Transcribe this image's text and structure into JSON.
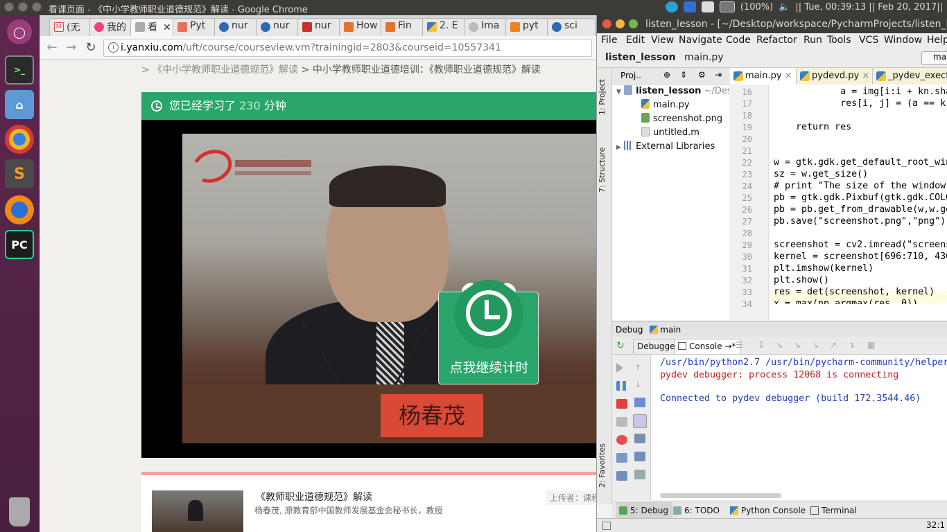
{
  "top_panel": {
    "title": "看课页面 - 《中小学教师职业道德规范》解读 - Google Chrome",
    "battery": "(100%)",
    "clock": "|| Tue, 00:39:13 || Feb 20, 2017||"
  },
  "launcher": {
    "apps": [
      "ubuntu-dash",
      "terminal",
      "files",
      "chrome",
      "sublime-text",
      "firefox",
      "pycharm",
      "trash"
    ]
  },
  "chrome": {
    "tabs": [
      {
        "label": "(无",
        "icon": "gmail-icon"
      },
      {
        "label": "我的",
        "icon": "flower-icon"
      },
      {
        "label": "看",
        "icon": "speaker-icon",
        "active": true
      },
      {
        "label": "Pyt",
        "icon": "jianshu-icon"
      },
      {
        "label": "nur",
        "icon": "blog-icon"
      },
      {
        "label": "nur",
        "icon": "blog-icon"
      },
      {
        "label": "nur",
        "icon": "csdn-icon"
      },
      {
        "label": "Hoᴡ",
        "icon": "matlab-icon"
      },
      {
        "label": "Fin",
        "icon": "matlab-icon"
      },
      {
        "label": "2. E",
        "icon": "python-icon"
      },
      {
        "label": "Ima",
        "icon": "at-icon"
      },
      {
        "label": "pyt",
        "icon": "stackoverflow-icon"
      },
      {
        "label": "sci",
        "icon": "blog-icon"
      }
    ],
    "url_host": "i.yanxiu.com",
    "url_path": "/uft/course/courseview.vm?trainingid=2803&courseid=10557341",
    "breadcrumb_prefix": "> 《中小学教师职业道德规范》解读",
    "breadcrumb_current": "> 中小学教师职业道德培训：《教师职业道德规范》解读",
    "study_prefix": "您已经学习了",
    "study_minutes": "230",
    "study_suffix": "分钟",
    "nameplate": "杨春茂",
    "timer_button": "点我继续计时",
    "course_title": "《教师职业道德规范》解读",
    "course_desc": "杨春茂, 原教育部中国教师发展基金会秘书长，教授",
    "uploader": "上传者：课程"
  },
  "pycharm": {
    "title": "listen_lesson - [~/Desktop/workspace/PycharmProjects/listen_lesso",
    "menu": [
      "File",
      "Edit",
      "View",
      "Navigate",
      "Code",
      "Refactor",
      "Run",
      "Tools",
      "VCS",
      "Window",
      "Help"
    ],
    "nav_project": "listen_lesson",
    "nav_file": "main.py",
    "run_config": "ma",
    "project_panel_label": "Proj..",
    "side_tabs": [
      "1: Project",
      "7: Structure",
      "2: Favorites"
    ],
    "tree": [
      {
        "label": "listen_lesson",
        "suffix": "~/Desk",
        "type": "folder"
      },
      {
        "label": "main.py",
        "type": "py"
      },
      {
        "label": "screenshot.png",
        "type": "png"
      },
      {
        "label": "untitled.m",
        "type": "m"
      },
      {
        "label": "External Libraries",
        "type": "lib"
      }
    ],
    "editor_tabs": [
      "main.py",
      "pydevd.py",
      "_pydev_execf"
    ],
    "line_numbers": [
      "16",
      "17",
      "18",
      "19",
      "20",
      "21",
      "22",
      "23",
      "24",
      "25",
      "26",
      "27",
      "28",
      "29",
      "30",
      "31",
      "32",
      "33",
      "34"
    ],
    "code_lines": [
      "            a = img[i:i + kn.sha",
      "            res[i, j] = (a == kr",
      "",
      "    return res",
      "",
      "",
      "w = gtk.gdk.get_default_root_win",
      "sz = w.get_size()",
      "# print \"The size of the window",
      "pb = gtk.gdk.Pixbuf(gtk.gdk.COLO",
      "pb = pb.get_from_drawable(w,w.ge",
      "pb.save(\"screenshot.png\",\"png\")",
      "",
      "screenshot = cv2.imread(\"screens",
      "kernel = screenshot[696:710, 430",
      "plt.imshow(kernel)",
      "plt.show()",
      "res = det(screenshot, kernel)",
      "x = max(np.argmax(res, 0))"
    ],
    "debug_label": "Debug",
    "debug_config": "main",
    "debug_tabs": [
      "Debugger",
      "Console"
    ],
    "console": {
      "line1": "/usr/bin/python2.7 /usr/bin/pycharm-community/helper",
      "line2": "pydev debugger: process 12068 is connecting",
      "line3": "Connected to pydev debugger (build 172.3544.46)"
    },
    "bottom_tabs": [
      "5: Debug",
      "6: TODO",
      "Python Console",
      "Terminal"
    ],
    "cursor_pos": "32:1"
  }
}
